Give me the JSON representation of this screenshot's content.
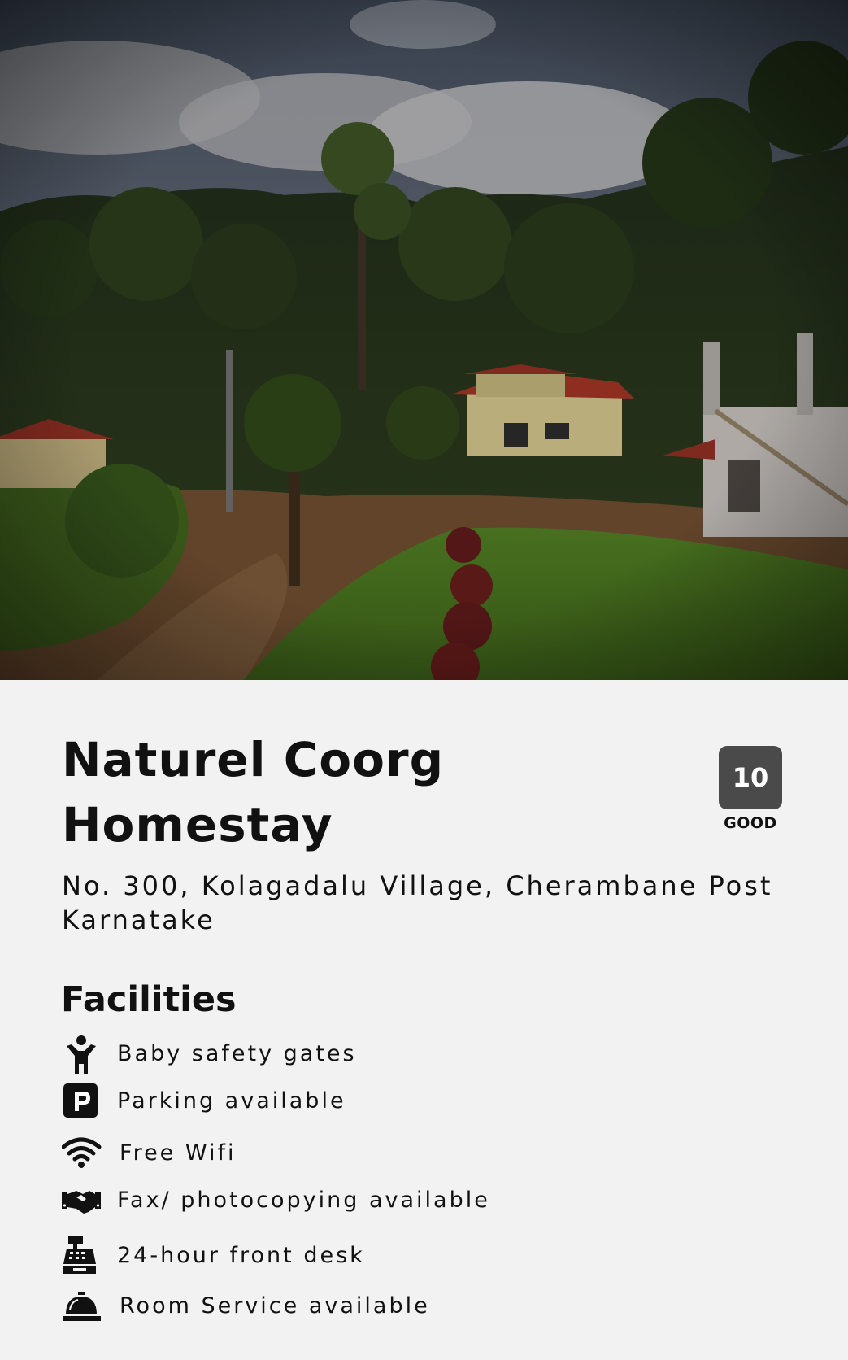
{
  "property": {
    "name_line1": "Naturel Coorg",
    "name_line2": "Homestay",
    "address_line1": "No. 300, Kolagadalu Village, Cherambane Post",
    "address_line2": "Karnatake",
    "rating": {
      "score": "10",
      "label": "GOOD"
    }
  },
  "facilities": {
    "heading": "Facilities",
    "items": [
      {
        "label": "Baby safety gates",
        "icon": "child-icon"
      },
      {
        "label": "Parking available",
        "icon": "parking-icon"
      },
      {
        "label": "Free Wifi",
        "icon": "wifi-icon"
      },
      {
        "label": "Fax/ photocopying available",
        "icon": "handshake-icon"
      },
      {
        "label": "24-hour front desk",
        "icon": "cash-register-icon"
      },
      {
        "label": "Room Service available",
        "icon": "service-bell-icon"
      }
    ]
  },
  "colors": {
    "background": "#f2f2f2",
    "text": "#111111",
    "rating_badge": "#4a4a4a"
  }
}
